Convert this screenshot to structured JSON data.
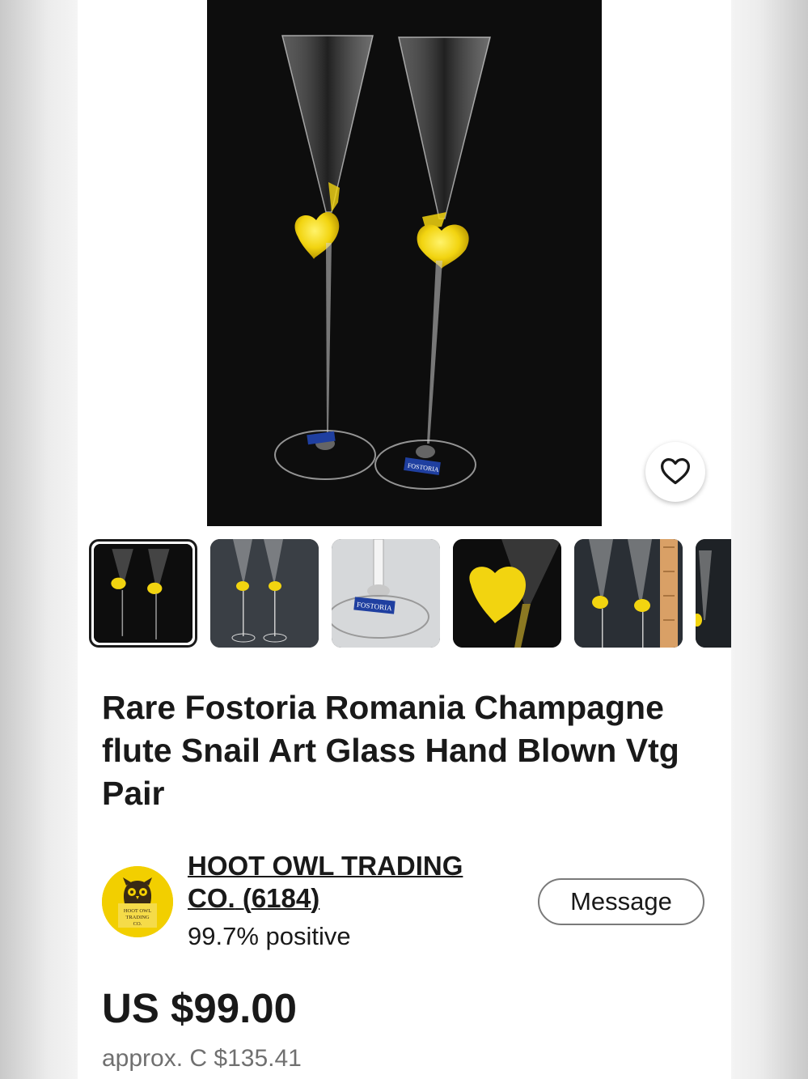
{
  "listing": {
    "title": "Rare Fostoria Romania Champagne flute Snail Art Glass Hand Blown Vtg Pair",
    "price": "US $99.00",
    "approx_price": "approx. C $135.41",
    "photo_label": "FOSTORIA",
    "thumbnail_count": 6,
    "selected_thumbnail": 1
  },
  "seller": {
    "name": "HOOT OWL TRADING CO.",
    "feedback_count": "(6184)",
    "feedback_percent": "99.7% positive",
    "logo_text": [
      "HOOT OWL",
      "TRADING",
      "CO."
    ]
  },
  "actions": {
    "message_label": "Message",
    "favorite_icon": "heart-icon"
  },
  "colors": {
    "text": "#191919",
    "muted": "#707070",
    "accent_yellow": "#f2d410",
    "photo_background": "#0d0d0d"
  }
}
